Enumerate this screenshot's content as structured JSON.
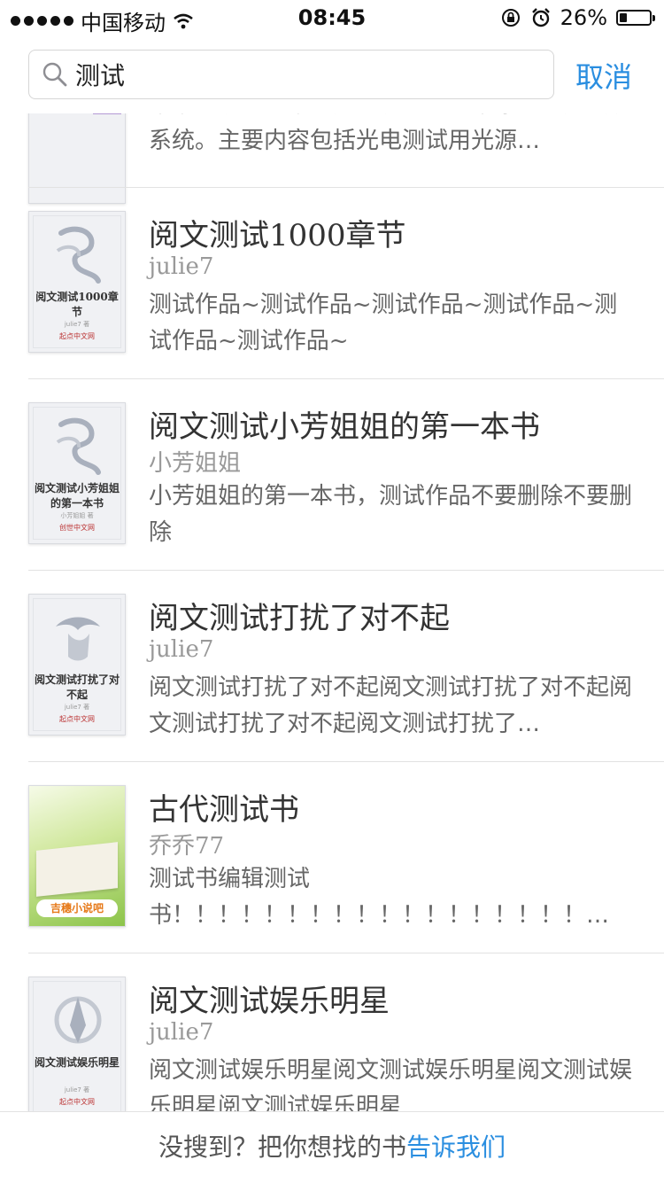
{
  "status_bar": {
    "carrier": "中国移动",
    "time": "08:45",
    "battery_percent": "26%",
    "battery_level": 0.26
  },
  "search": {
    "query": "测试",
    "placeholder": "",
    "cancel_label": "取消"
  },
  "results": [
    {
      "title": "",
      "author": "",
      "description": "本书系统地介绍了光电测试的基本原理、方法及系统。主要内容包括光电测试用光源…",
      "cover_title": "",
      "cover_author": "",
      "cover_publisher": ""
    },
    {
      "title": "阅文测试1000章节",
      "author": "julie7",
      "description": "测试作品~测试作品~测试作品~测试作品~测试作品~测试作品~",
      "cover_title": "阅文测试1000章节",
      "cover_author": "julie7 著",
      "cover_publisher": "起点中文网"
    },
    {
      "title": "阅文测试小芳姐姐的第一本书",
      "author": "小芳姐姐",
      "description": "小芳姐姐的第一本书，测试作品不要删除不要删除",
      "cover_title": "阅文测试小芳姐姐的第一本书",
      "cover_author": "小芳姐姐 著",
      "cover_publisher": "创世中文网"
    },
    {
      "title": "阅文测试打扰了对不起",
      "author": "julie7",
      "description": "阅文测试打扰了对不起阅文测试打扰了对不起阅文测试打扰了对不起阅文测试打扰了…",
      "cover_title": "阅文测试打扰了对不起",
      "cover_author": "julie7 著",
      "cover_publisher": "起点中文网"
    },
    {
      "title": "古代测试书",
      "author": "乔乔77",
      "description": "测试书编辑测试书！！！！！！！！！！！！！！！！！！…",
      "cover_title": "",
      "cover_author": "",
      "cover_publisher": "吉穗小说吧"
    },
    {
      "title": "阅文测试娱乐明星",
      "author": "julie7",
      "description": "阅文测试娱乐明星阅文测试娱乐明星阅文测试娱乐明星阅文测试娱乐明星",
      "cover_title": "阅文测试娱乐明星",
      "cover_author": "julie7 著",
      "cover_publisher": "起点中文网"
    }
  ],
  "footer": {
    "prompt": "没搜到？把你想找的书",
    "link": "告诉我们"
  },
  "colors": {
    "accent": "#2a8ee0",
    "title_text": "#333333",
    "author_text": "#999999",
    "desc_text": "#666666"
  }
}
